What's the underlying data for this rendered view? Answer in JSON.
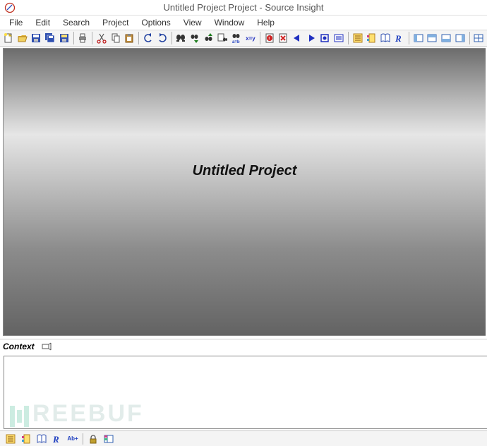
{
  "title": "Untitled Project Project - Source Insight",
  "menus": [
    "File",
    "Edit",
    "Search",
    "Project",
    "Options",
    "View",
    "Window",
    "Help"
  ],
  "document_title": "Untitled Project",
  "context_label": "Context",
  "toolbar_groups": [
    [
      "new-file",
      "open-file",
      "save-file",
      "save-all",
      "close-file"
    ],
    [
      "print"
    ],
    [
      "cut",
      "copy",
      "paste"
    ],
    [
      "undo",
      "redo"
    ],
    [
      "find",
      "find-next",
      "find-prev",
      "find-in-files",
      "replace",
      "rename"
    ],
    [
      "bookmark-error",
      "bookmark-delete",
      "nav-back",
      "nav-fwd",
      "nav-record",
      "nav-list"
    ],
    [
      "symbol-window",
      "project-symbols",
      "browse-book",
      "relation-r"
    ],
    [
      "panel-left",
      "panel-top",
      "panel-bottom",
      "panel-right"
    ],
    [
      "panel-tile"
    ]
  ],
  "statusbar_items": [
    "symbol-window",
    "project-symbols",
    "browse-book",
    "relation-r",
    "abplus"
  ],
  "statusbar_right": [
    "lock",
    "list-box"
  ],
  "icon_labels": {
    "rename": "x=y",
    "abplus": "Ab+"
  },
  "watermark_text": "REEBUF"
}
